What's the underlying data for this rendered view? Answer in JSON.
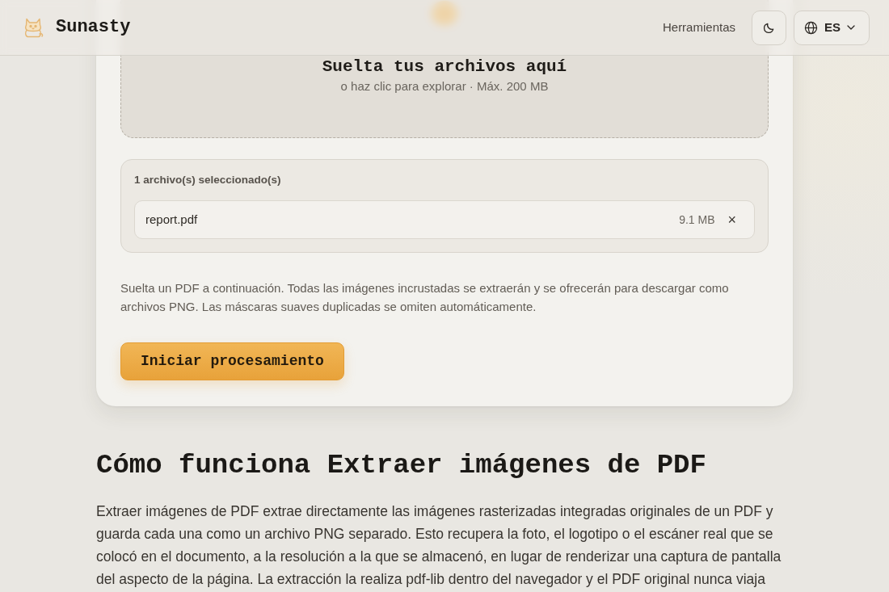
{
  "header": {
    "logo_text": "Sunasty",
    "nav_link": "Herramientas",
    "language": "ES"
  },
  "dropzone": {
    "title": "Suelta tus archivos aquí",
    "subtitle": "o haz clic para explorar · Máx. 200 MB"
  },
  "file_list": {
    "label": "1 archivo(s) seleccionado(s)",
    "files": [
      {
        "name": "report.pdf",
        "size": "9.1 MB",
        "remove": "×"
      }
    ]
  },
  "description": "Suelta un PDF a continuación. Todas las imágenes incrustadas se extraerán y se ofrecerán para descargar como archivos PNG. Las máscaras suaves duplicadas se omiten automáticamente.",
  "start_button": "Iniciar procesamiento",
  "section": {
    "heading": "Cómo funciona Extraer imágenes de PDF",
    "paragraph": "Extraer imágenes de PDF extrae directamente las imágenes rasterizadas integradas originales de un PDF y guarda cada una como un archivo PNG separado. Esto recupera la foto, el logotipo o el escáner real que se colocó en el documento, a la resolución a la que se almacenó, en lugar de renderizar una captura de pantalla del aspecto de la página. La extracción la realiza pdf-lib dentro del navegador y el PDF original nunca viaja"
  }
}
